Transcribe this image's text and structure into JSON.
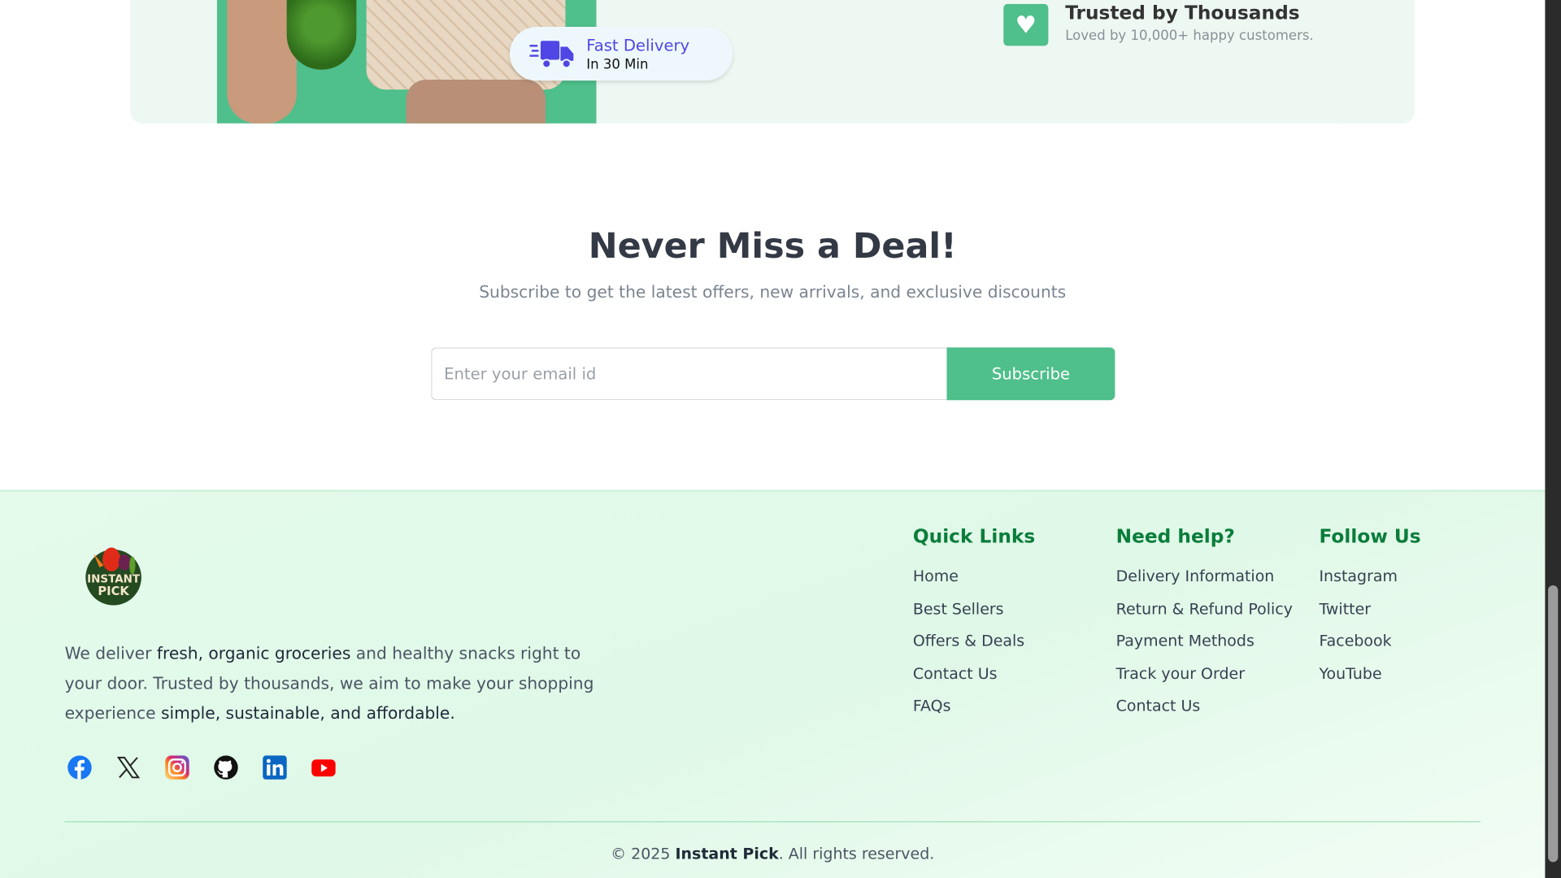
{
  "banner": {
    "fast_delivery_title": "Fast Delivery",
    "fast_delivery_sub": "In 30 Min",
    "trust_title": "Trusted by Thousands",
    "trust_sub": "Loved by 10,000+ happy customers."
  },
  "newsletter": {
    "title": "Never Miss a Deal!",
    "subtitle": "Subscribe to get the latest offers, new arrivals, and exclusive discounts",
    "email_placeholder": "Enter your email id",
    "email_value": "",
    "subscribe_label": "Subscribe"
  },
  "footer": {
    "logo_text": "INSTANT PICK",
    "about": {
      "p1": "We deliver ",
      "b1": "fresh, organic groceries",
      "p2": " and healthy snacks right to your door. Trusted by thousands, we aim to make your shopping experience ",
      "b2": "simple, sustainable, and affordable."
    },
    "social": [
      "facebook-icon",
      "x-icon",
      "instagram-icon",
      "github-icon",
      "linkedin-icon",
      "youtube-icon"
    ],
    "columns": [
      {
        "title": "Quick Links",
        "links": [
          "Home",
          "Best Sellers",
          "Offers & Deals",
          "Contact Us",
          "FAQs"
        ]
      },
      {
        "title": "Need help?",
        "links": [
          "Delivery Information",
          "Return & Refund Policy",
          "Payment Methods",
          "Track your Order",
          "Contact Us"
        ]
      },
      {
        "title": "Follow Us",
        "links": [
          "Instagram",
          "Twitter",
          "Facebook",
          "YouTube"
        ]
      }
    ],
    "copyright_pre": "© 2025 ",
    "copyright_brand": "Instant Pick",
    "copyright_post": ". All rights reserved."
  },
  "colors": {
    "accent": "#4fbf8b",
    "heading_green": "#0a7d3b",
    "delivery_purple": "#4f46e5"
  }
}
